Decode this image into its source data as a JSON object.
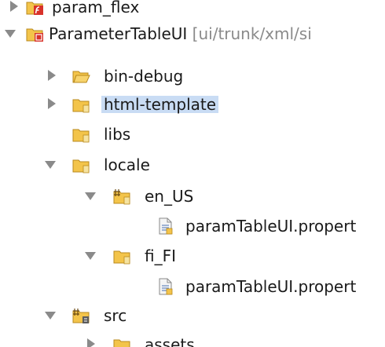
{
  "tree": {
    "items": [
      {
        "label": "param_flex",
        "suffix": ""
      },
      {
        "label": "ParameterTableUI",
        "suffix": "[ui/trunk/xml/si"
      },
      {
        "label": "bin-debug",
        "suffix": ""
      },
      {
        "label": "html-template",
        "suffix": ""
      },
      {
        "label": "libs",
        "suffix": ""
      },
      {
        "label": "locale",
        "suffix": ""
      },
      {
        "label": "en_US",
        "suffix": ""
      },
      {
        "label": "paramTableUI.propert",
        "suffix": ""
      },
      {
        "label": "fi_FI",
        "suffix": ""
      },
      {
        "label": "paramTableUI.propert",
        "suffix": ""
      },
      {
        "label": "src",
        "suffix": ""
      },
      {
        "label": "assets",
        "suffix": ""
      }
    ]
  },
  "colors": {
    "selection": "#c9dcf4",
    "folder": "#f3c44a",
    "flex_red": "#d8322a",
    "triangle": "#8a8a8a"
  }
}
